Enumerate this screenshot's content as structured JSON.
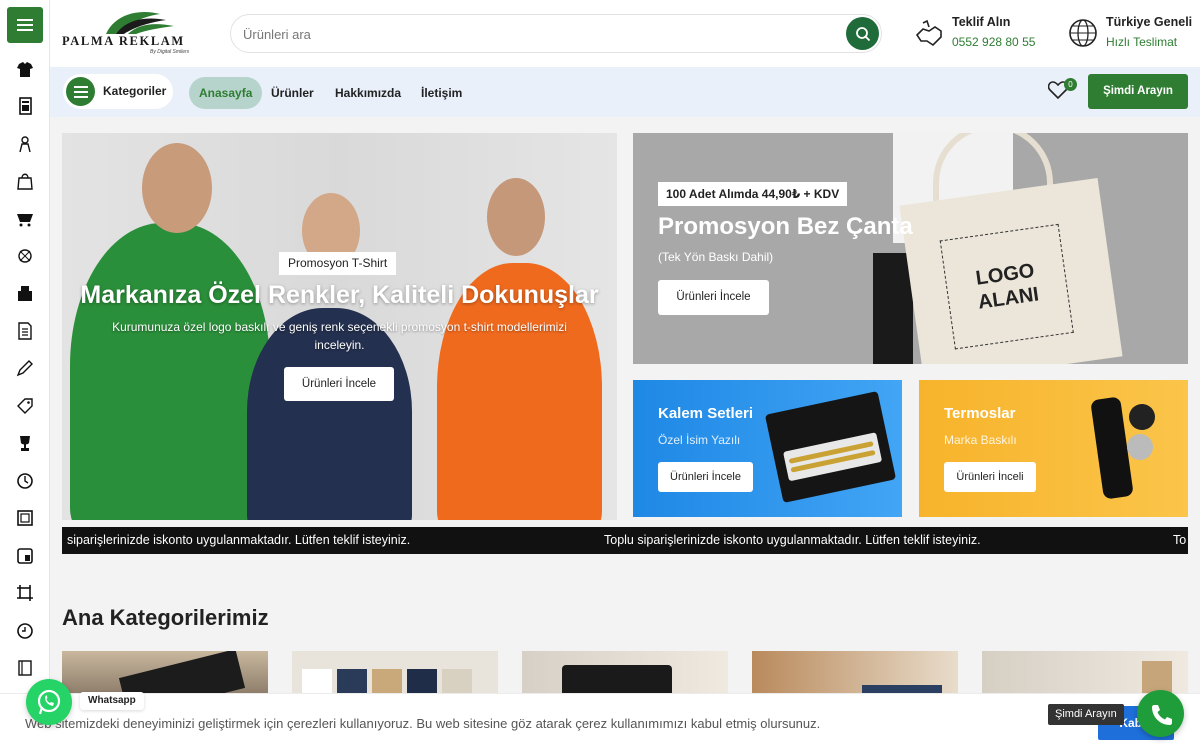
{
  "brand": {
    "name": "PALMA REKLAM",
    "tagline": "By Digital Smilers"
  },
  "search": {
    "placeholder": "Ürünleri ara"
  },
  "header_info": [
    {
      "title": "Teklif Alın",
      "subtitle": "0552 928 80 55",
      "icon": "handshake-icon"
    },
    {
      "title": "Türkiye Geneli",
      "subtitle": "Hızlı Teslimat",
      "icon": "globe-icon"
    }
  ],
  "nav": {
    "categories_label": "Kategoriler",
    "links": [
      "Anasayfa",
      "Ürünler",
      "Hakkımızda",
      "İletişim"
    ],
    "active": "Anasayfa",
    "wishlist_count": "0",
    "call_label": "Şimdi Arayın"
  },
  "hero": {
    "tag": "Promosyon T-Shirt",
    "title": "Markanıza Özel Renkler, Kaliteli Dokunuşlar",
    "text": "Kurumunuza özel logo baskılı ve geniş renk seçenekli promosyon t-shirt modellerimizi inceleyin.",
    "button": "Ürünleri İncele"
  },
  "bag_promo": {
    "tag": "100 Adet Alımda 44,90₺ + KDV",
    "title": "Promosyon Bez Çanta",
    "subtitle": "(Tek Yön Baskı Dahil)",
    "button": "Ürünleri İncele",
    "logo_text_1": "LOGO",
    "logo_text_2": "ALANI"
  },
  "pen_promo": {
    "title": "Kalem Setleri",
    "subtitle": "Özel İsim Yazılı",
    "button": "Ürünleri İncele"
  },
  "thermo_promo": {
    "title": "Termoslar",
    "subtitle": "Marka Baskılı",
    "button": "Ürünleri İnceli"
  },
  "ticker": {
    "text_partial": "siparişlerinizde iskonto uygulanmaktadır. Lütfen teklif isteyiniz.",
    "text_full": "Toplu siparişlerinizde iskonto uygulanmaktadır. Lütfen teklif isteyiniz.",
    "text_tail": "To"
  },
  "categories_title": "Ana Kategorilerimiz",
  "cookie": {
    "text": "Web sitemizdeki deneyiminizi geliştirmek için çerezleri kullanıyoruz. Bu web sitesine göz atarak çerez kullanımımızı kabul etmiş olursunuz.",
    "accept": "Kabul"
  },
  "whatsapp": {
    "label": "Whatsapp"
  },
  "call_float": {
    "label": "Şimdi Arayın"
  },
  "rail_icons": [
    "tshirt-icon",
    "notebook-icon",
    "person-icon",
    "bag-icon",
    "basket-icon",
    "gift-icon",
    "box-icon",
    "document-icon",
    "pen-icon",
    "tag-icon",
    "trophy-icon",
    "clock-icon",
    "frame-icon",
    "calendar-icon",
    "crop-icon",
    "watch-icon",
    "book-icon"
  ],
  "colors": {
    "brand_green": "#2e7d32",
    "nav_bg": "#e9f0fa",
    "pen_blue": "#1e88e5",
    "thermo_yellow": "#f7b32b",
    "whatsapp": "#25d366"
  }
}
